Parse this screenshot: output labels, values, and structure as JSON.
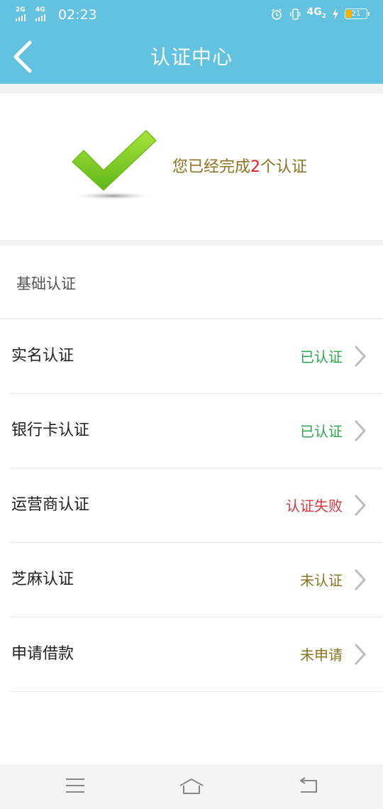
{
  "status_bar": {
    "network1": "2G",
    "network2": "4G",
    "time": "02:23",
    "network_right": "4G",
    "network_right_sub": "2",
    "battery": "21"
  },
  "nav": {
    "title": "认证中心"
  },
  "hero": {
    "text_before": "您已经完成",
    "count": "2",
    "text_after": "个认证"
  },
  "section": {
    "title": "基础认证"
  },
  "items": [
    {
      "label": "实名认证",
      "status": "已认证",
      "status_color": "#2aa84a"
    },
    {
      "label": "银行卡认证",
      "status": "已认证",
      "status_color": "#2aa84a"
    },
    {
      "label": "运营商认证",
      "status": "认证失败",
      "status_color": "#d9363e"
    },
    {
      "label": "芝麻认证",
      "status": "未认证",
      "status_color": "#8a7321"
    },
    {
      "label": "申请借款",
      "status": "未申请",
      "status_color": "#8a7321"
    }
  ],
  "colors": {
    "header": "#63c2e0",
    "hero_text": "#8a7321",
    "count": "#e02020"
  }
}
